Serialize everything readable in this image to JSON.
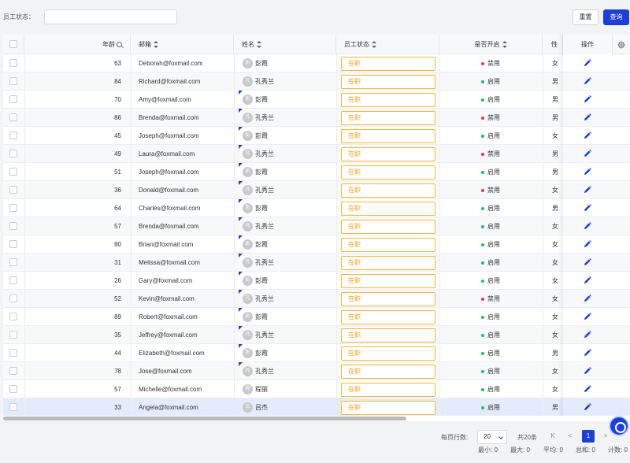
{
  "filter": {
    "label": "员工状态：",
    "input_value": "",
    "reset_label": "重置",
    "query_label": "查询"
  },
  "columns": {
    "age": "年龄",
    "email": "邮箱",
    "name": "姓名",
    "status": "员工状态",
    "enabled": "是否开启",
    "gender": "性别",
    "actions": "操作"
  },
  "icons": {
    "settings": "gear-icon",
    "edit": "pencil-icon",
    "search": "search-icon",
    "sort": "sort-icon"
  },
  "colors": {
    "primary": "#1d3fd8",
    "status_border": "#f7b737",
    "enabled_dot": "#20c05c",
    "disabled_dot": "#e8383d"
  },
  "rows": [
    {
      "age": "63",
      "email": "Deborah@foxmail.com",
      "avatar": "彭",
      "name": "彭霞",
      "status": "在职",
      "enabled": "禁用",
      "enabled_state": "off",
      "gender": "女",
      "marked": false,
      "selected": false
    },
    {
      "age": "84",
      "email": "Richard@foxmail.com",
      "avatar": "孔",
      "name": "孔秀兰",
      "status": "在职",
      "enabled": "启用",
      "enabled_state": "on",
      "gender": "男",
      "marked": false,
      "selected": false
    },
    {
      "age": "70",
      "email": "Amy@foxmail.com",
      "avatar": "彭",
      "name": "彭霞",
      "status": "在职",
      "enabled": "启用",
      "enabled_state": "on",
      "gender": "男",
      "marked": true,
      "selected": false
    },
    {
      "age": "86",
      "email": "Brenda@foxmail.com",
      "avatar": "孔",
      "name": "孔秀兰",
      "status": "在职",
      "enabled": "禁用",
      "enabled_state": "off",
      "gender": "男",
      "marked": true,
      "selected": false
    },
    {
      "age": "45",
      "email": "Joseph@foxmail.com",
      "avatar": "彭",
      "name": "彭霞",
      "status": "在职",
      "enabled": "启用",
      "enabled_state": "on",
      "gender": "女",
      "marked": true,
      "selected": false
    },
    {
      "age": "49",
      "email": "Laura@foxmail.com",
      "avatar": "孔",
      "name": "孔秀兰",
      "status": "在职",
      "enabled": "禁用",
      "enabled_state": "off",
      "gender": "男",
      "marked": true,
      "selected": false
    },
    {
      "age": "51",
      "email": "Joseph@foxmail.com",
      "avatar": "彭",
      "name": "彭霞",
      "status": "在职",
      "enabled": "启用",
      "enabled_state": "on",
      "gender": "男",
      "marked": true,
      "selected": false
    },
    {
      "age": "36",
      "email": "Donald@foxmail.com",
      "avatar": "孔",
      "name": "孔秀兰",
      "status": "在职",
      "enabled": "禁用",
      "enabled_state": "off",
      "gender": "女",
      "marked": true,
      "selected": false
    },
    {
      "age": "64",
      "email": "Charles@foxmail.com",
      "avatar": "彭",
      "name": "彭霞",
      "status": "在职",
      "enabled": "启用",
      "enabled_state": "on",
      "gender": "男",
      "marked": true,
      "selected": false
    },
    {
      "age": "57",
      "email": "Brenda@foxmail.com",
      "avatar": "孔",
      "name": "孔秀兰",
      "status": "在职",
      "enabled": "启用",
      "enabled_state": "on",
      "gender": "女",
      "marked": true,
      "selected": false
    },
    {
      "age": "80",
      "email": "Brian@foxmail.com",
      "avatar": "彭",
      "name": "彭霞",
      "status": "在职",
      "enabled": "启用",
      "enabled_state": "on",
      "gender": "女",
      "marked": true,
      "selected": false
    },
    {
      "age": "31",
      "email": "Melissa@foxmail.com",
      "avatar": "孔",
      "name": "孔秀兰",
      "status": "在职",
      "enabled": "启用",
      "enabled_state": "on",
      "gender": "女",
      "marked": true,
      "selected": false
    },
    {
      "age": "26",
      "email": "Gary@foxmail.com",
      "avatar": "彭",
      "name": "彭霞",
      "status": "在职",
      "enabled": "启用",
      "enabled_state": "on",
      "gender": "女",
      "marked": true,
      "selected": false
    },
    {
      "age": "52",
      "email": "Kevin@foxmail.com",
      "avatar": "孔",
      "name": "孔秀兰",
      "status": "在职",
      "enabled": "禁用",
      "enabled_state": "off",
      "gender": "女",
      "marked": true,
      "selected": false
    },
    {
      "age": "89",
      "email": "Robert@foxmail.com",
      "avatar": "彭",
      "name": "彭霞",
      "status": "在职",
      "enabled": "启用",
      "enabled_state": "on",
      "gender": "女",
      "marked": true,
      "selected": false
    },
    {
      "age": "35",
      "email": "Jeffrey@foxmail.com",
      "avatar": "孔",
      "name": "孔秀兰",
      "status": "在职",
      "enabled": "启用",
      "enabled_state": "on",
      "gender": "女",
      "marked": true,
      "selected": false
    },
    {
      "age": "44",
      "email": "Elizabeth@foxmail.com",
      "avatar": "彭",
      "name": "彭霞",
      "status": "在职",
      "enabled": "启用",
      "enabled_state": "on",
      "gender": "男",
      "marked": true,
      "selected": false
    },
    {
      "age": "78",
      "email": "Jose@foxmail.com",
      "avatar": "孔",
      "name": "孔秀兰",
      "status": "在职",
      "enabled": "启用",
      "enabled_state": "on",
      "gender": "女",
      "marked": true,
      "selected": false
    },
    {
      "age": "57",
      "email": "Michelle@foxmail.com",
      "avatar": "程",
      "name": "程丽",
      "status": "在职",
      "enabled": "启用",
      "enabled_state": "on",
      "gender": "女",
      "marked": false,
      "selected": false
    },
    {
      "age": "33",
      "email": "Angela@foxmail.com",
      "avatar": "吕",
      "name": "吕杰",
      "status": "在职",
      "enabled": "启用",
      "enabled_state": "on",
      "gender": "男",
      "marked": false,
      "selected": true
    }
  ],
  "pagination": {
    "page_size_label": "每页行数:",
    "page_size": "20",
    "total": "共20条",
    "first": "K",
    "prev": "<",
    "current": "1",
    "next": ">"
  },
  "summary": {
    "min": "最小: 0",
    "max": "最大: 0",
    "avg": "平均: 0",
    "sum": "总和: 0",
    "count": "计数: 0"
  }
}
